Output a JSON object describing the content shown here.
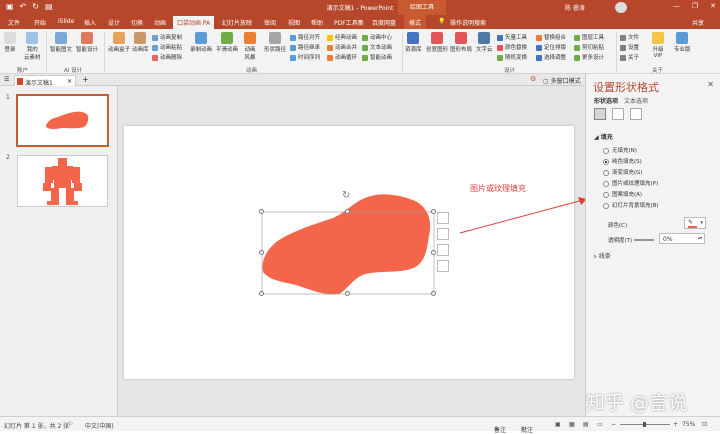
{
  "window": {
    "title": "演示文稿1 - PowerPoint",
    "context_tab": "绘图工具",
    "user": "陈 睿涛",
    "minimize": "—",
    "restore": "❐",
    "close": "✕"
  },
  "tabs": [
    "文件",
    "开始",
    "iSlide",
    "插入",
    "设计",
    "切换",
    "动画",
    "口袋动画 PA",
    "幻灯片放映",
    "审阅",
    "视图",
    "帮助",
    "PDF工具集",
    "百度网盘",
    "格式"
  ],
  "tell_me": "操作说明搜索",
  "share": "共享",
  "ribbon": {
    "login": "登录",
    "my_cloud": "我的\n云素材",
    "smart_graphic": "智能图文",
    "smart_design": "智能设计",
    "anim_box": "动画盒子",
    "anim_lib": "动画库",
    "anim_copy": "动画复制",
    "anim_paste": "动画粘贴",
    "anim_delete": "动画删除",
    "rec_anim": "录制动画",
    "smooth_anim": "平滑动画",
    "anim_style": "动画\n风暴",
    "shape_path": "形状路径",
    "path_align": "路径对齐",
    "path_inherit": "路径继承",
    "time_seq": "时间序列",
    "classic_anim": "经典动画",
    "anim_merge": "动画合并",
    "anim_loop": "动画循环",
    "anim_center": "动画中心",
    "text_anim": "文本动画",
    "smart_anim": "智能动画",
    "res_lib": "资源库",
    "creative_shape": "创意图形",
    "shape_layout": "图形布局",
    "text_cloud": "文字云",
    "vector_tools": "矢量工具",
    "color_replace": "颜色替换",
    "random_color": "随机变换",
    "replace_combine": "替换组合",
    "position_arrange": "定位排版",
    "select_resize": "选择调整",
    "shape_tools": "图层工具",
    "cut_paste": "剪切粘贴",
    "more_design": "更多设计",
    "file": "文件",
    "settings": "设置",
    "about": "关于",
    "upgrade_vip": "升级\nVIP",
    "pro_edition": "专业版"
  },
  "groups": [
    "账户",
    "AI 设计",
    "动画",
    "设计",
    "关于"
  ],
  "doc_tab": "演示文稿1",
  "multi_window": "多窗口模式",
  "slides": [
    {
      "number": "1"
    },
    {
      "number": "2"
    }
  ],
  "annotation": "图片或纹理填充",
  "panel": {
    "title": "设置形状格式",
    "close": "✕",
    "sub_shape": "形状选项",
    "sub_text": "文本选项",
    "fill_section": "填充",
    "fill_options": [
      "无填充(N)",
      "纯色填充(S)",
      "渐变填充(G)",
      "图片或纹理填充(P)",
      "图案填充(A)",
      "幻灯片背景填充(B)"
    ],
    "color_label": "颜色(C)",
    "transparency_label": "透明度(T)",
    "transparency_value": "0%",
    "line_section": "线条"
  },
  "status": {
    "slide_info": "幻灯片 第 1 张，共 2 张",
    "language": "中文(中国)",
    "notes": "备注",
    "comments": "批注",
    "zoom": "75%"
  },
  "watermark": "知乎 @言说",
  "colors": {
    "accent": "#b7472a",
    "shape_fill": "#f46649",
    "annotation": "#e0403a"
  }
}
